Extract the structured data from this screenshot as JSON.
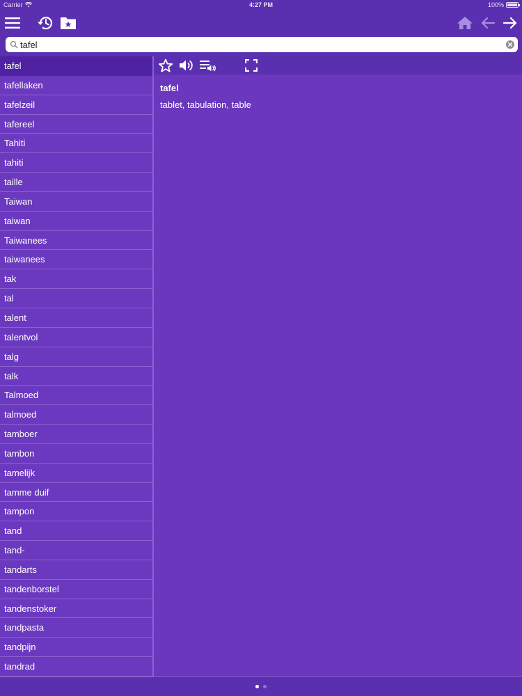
{
  "status": {
    "carrier": "Carrier",
    "time": "4:27 PM",
    "battery": "100%"
  },
  "toolbar": {
    "menu_icon": "menu-icon",
    "history_icon": "history-icon",
    "favorites_icon": "favorites-folder-icon",
    "home_icon": "home-icon",
    "back_icon": "arrow-left-icon",
    "forward_icon": "arrow-right-icon"
  },
  "search": {
    "value": "tafel",
    "placeholder": ""
  },
  "word_list": [
    "tafel",
    "tafellaken",
    "tafelzeil",
    "tafereel",
    "Tahiti",
    "tahiti",
    "taille",
    "Taiwan",
    "taiwan",
    "Taiwanees",
    "taiwanees",
    "tak",
    "tal",
    "talent",
    "talentvol",
    "talg",
    "talk",
    "Talmoed",
    "talmoed",
    "tamboer",
    "tambon",
    "tamelijk",
    "tamme duif",
    "tampon",
    "tand",
    "tand-",
    "tandarts",
    "tandenborstel",
    "tandenstoker",
    "tandpasta",
    "tandpijn",
    "tandrad"
  ],
  "selected_index": 0,
  "entry": {
    "word": "tafel",
    "definition": "tablet, tabulation, table"
  },
  "colors": {
    "background": "#5a2fb0",
    "list_bg": "#6b39bf",
    "selected": "#4e22a3",
    "detail_bg": "#6a37bd",
    "home_icon": "#a78ee0"
  }
}
